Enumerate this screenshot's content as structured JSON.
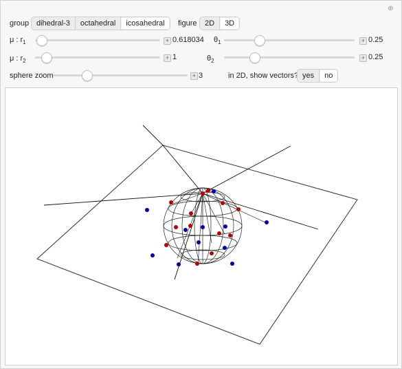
{
  "controls": {
    "group": {
      "label": "group",
      "options": [
        "dihedral-3",
        "octahedral",
        "icosahedral"
      ],
      "selected": "icosahedral"
    },
    "figure": {
      "label": "figure",
      "options": [
        "2D",
        "3D"
      ],
      "selected": "3D"
    },
    "mu_r1": {
      "label": "μ : r",
      "sub": "1",
      "value": "0.618034",
      "fraction": 0.05
    },
    "theta1": {
      "label": "θ",
      "sub": "1",
      "value": "0.25",
      "fraction": 0.25
    },
    "mu_r2": {
      "label": "μ : r",
      "sub": "2",
      "value": "1",
      "fraction": 0.1
    },
    "theta2": {
      "label": "θ",
      "sub": "2",
      "value": "0.25",
      "fraction": 0.25
    },
    "sphere_zoom": {
      "label": "sphere zoom",
      "value": "3",
      "fraction": 0.25
    },
    "show_vectors": {
      "label": "in 2D, show vectors?",
      "options": [
        "yes",
        "no"
      ],
      "selected": "no"
    }
  },
  "plot": {
    "red_point_color": "#b80000",
    "blue_point_color": "#0000a8",
    "line_color": "#000000"
  },
  "icons": {
    "reset": "reset-icon",
    "plus": "plus-icon"
  }
}
